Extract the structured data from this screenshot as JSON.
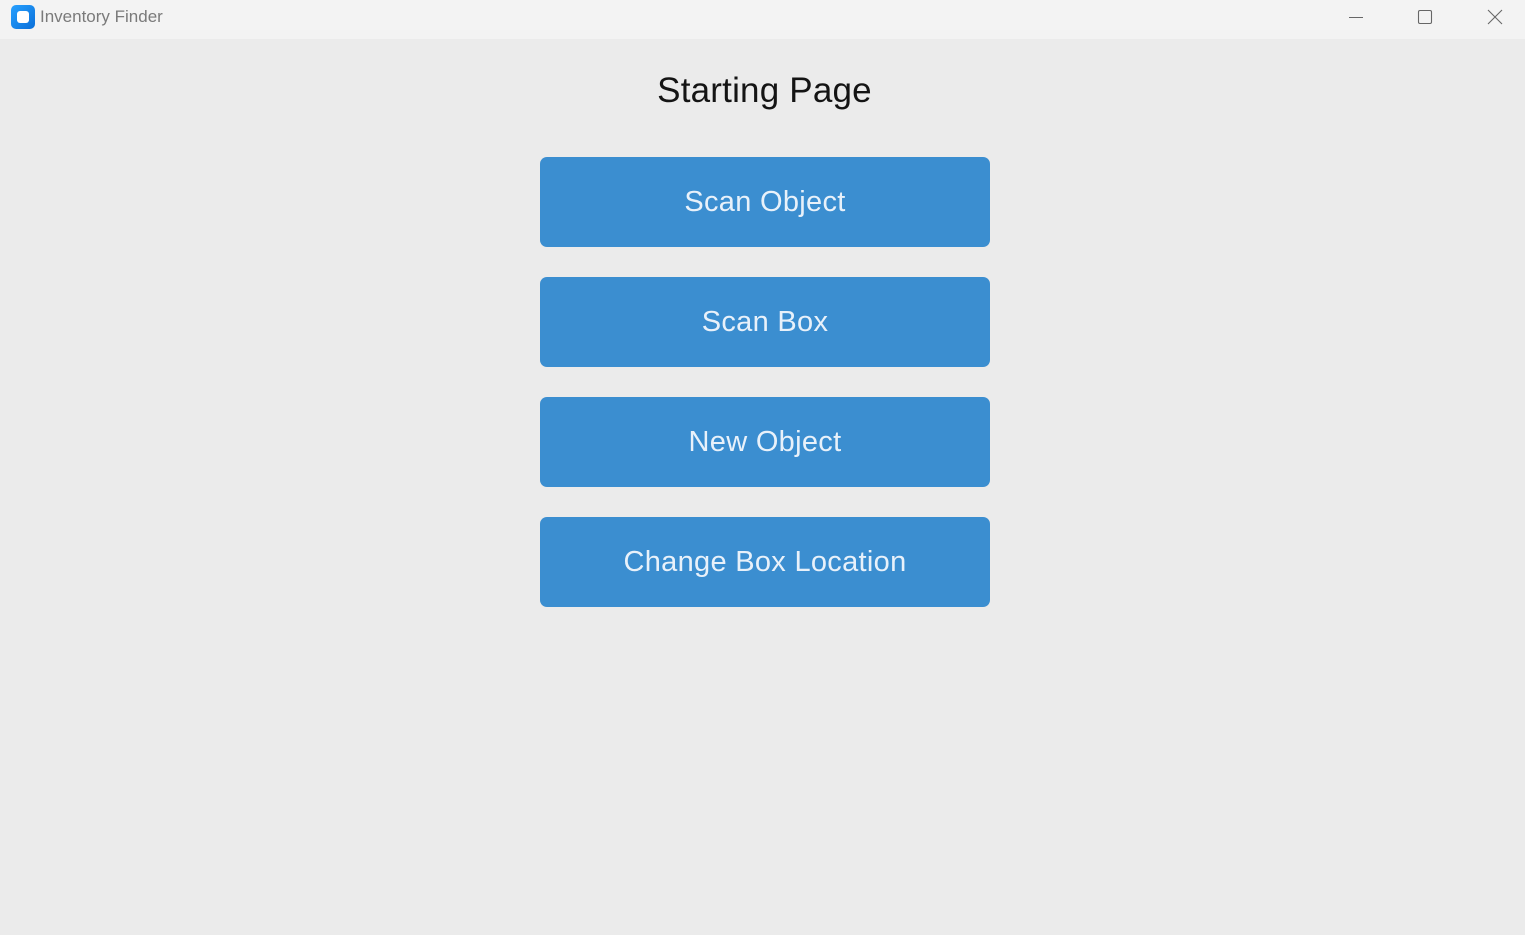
{
  "window": {
    "title": "Inventory Finder",
    "controls": {
      "minimize_icon": "minimize-icon",
      "maximize_icon": "maximize-icon",
      "close_icon": "close-icon"
    }
  },
  "page": {
    "title": "Starting Page"
  },
  "buttons": [
    {
      "label": "Scan Object"
    },
    {
      "label": "Scan Box"
    },
    {
      "label": "New Object"
    },
    {
      "label": "Change Box Location"
    }
  ],
  "colors": {
    "background": "#ebebeb",
    "titlebar": "#f3f3f3",
    "button_accent": "#3b8ed0",
    "button_text": "#e8f1fa"
  }
}
